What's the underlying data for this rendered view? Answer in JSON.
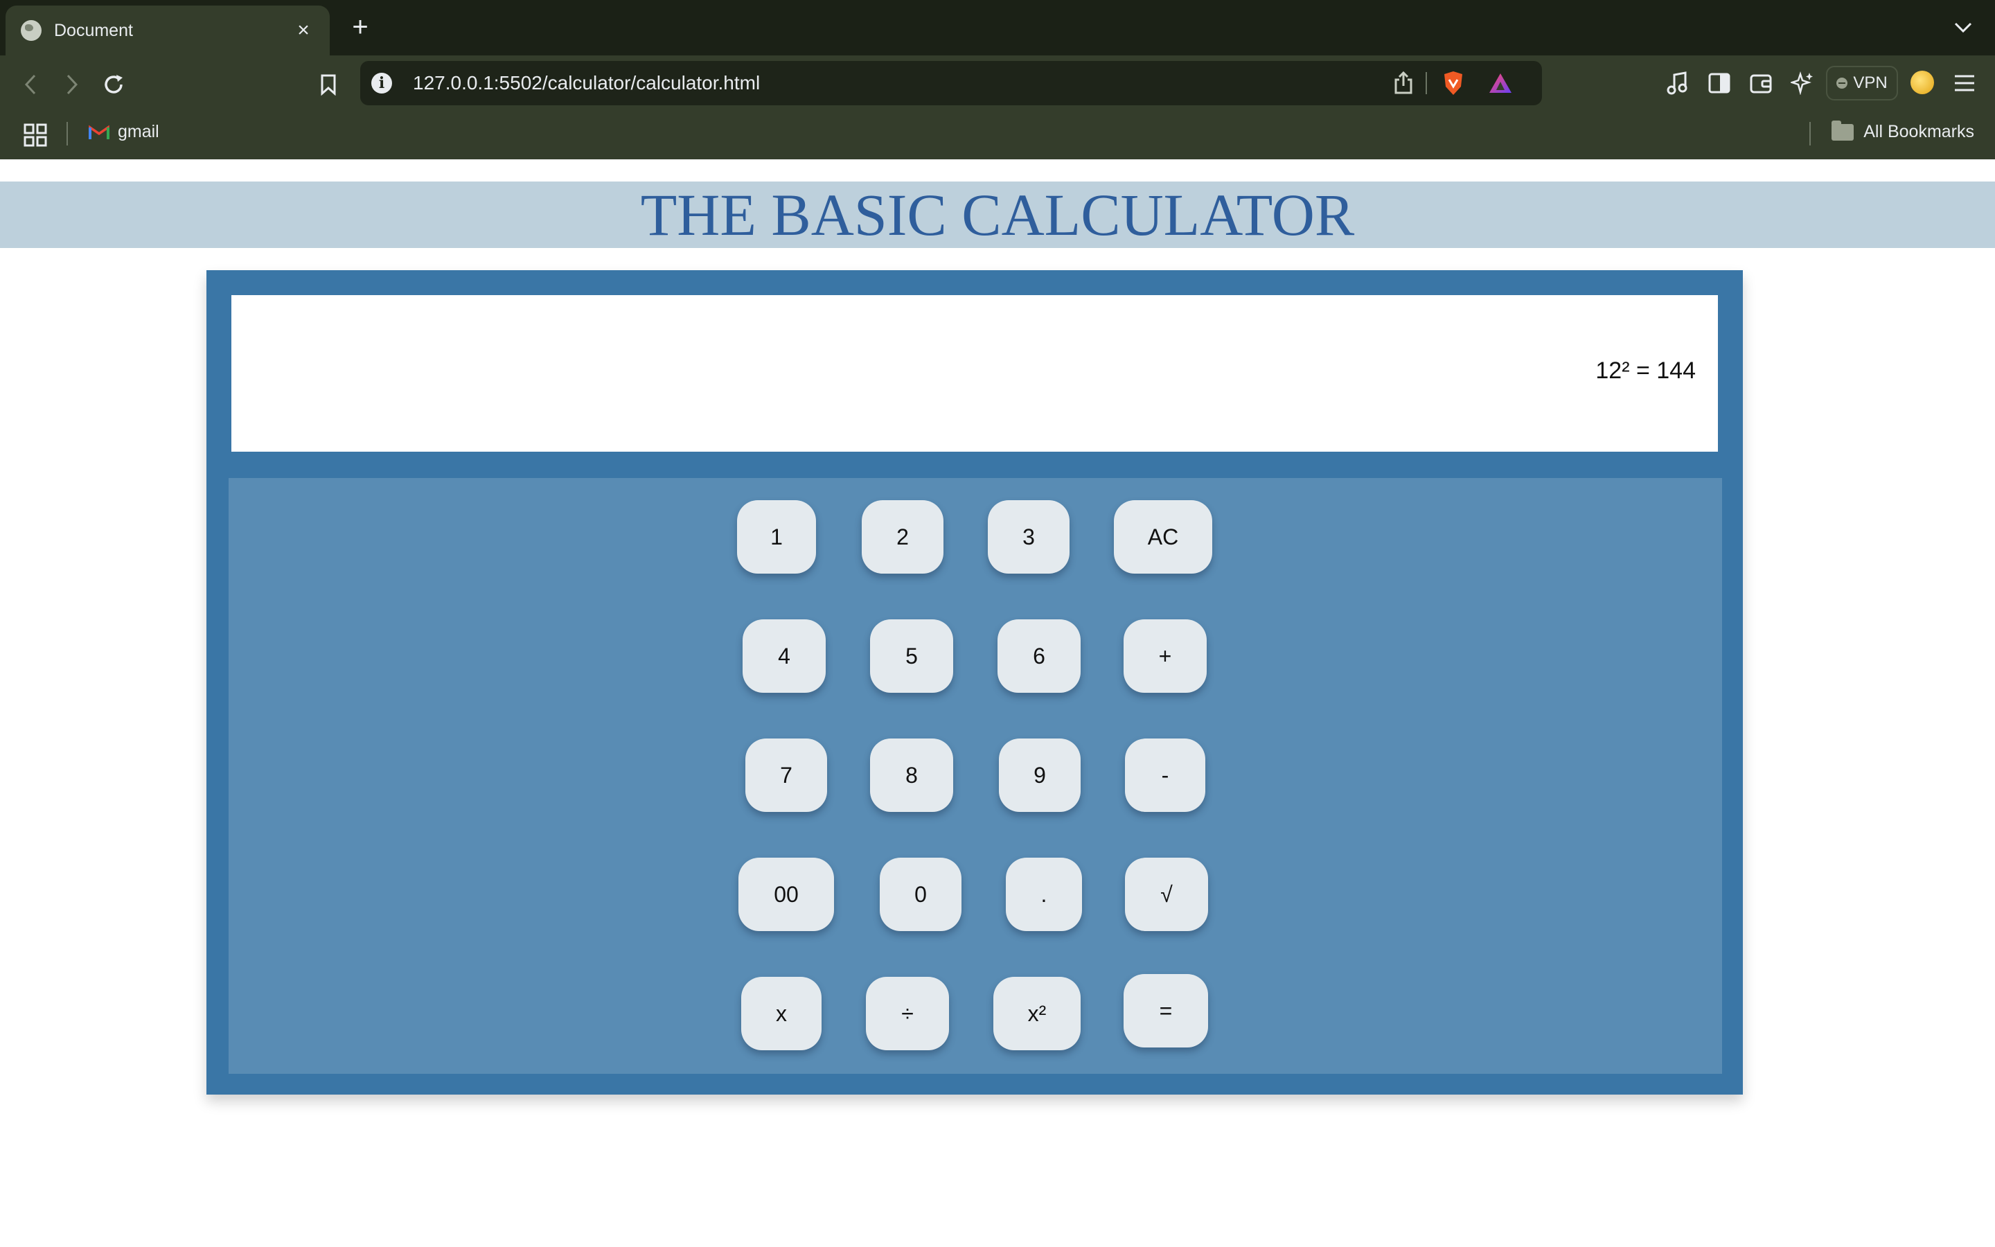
{
  "browser": {
    "tab_title": "Document",
    "url": "127.0.0.1:5502/calculator/calculator.html",
    "vpn_label": "VPN",
    "bookmarks": [
      {
        "label": "gmail"
      }
    ],
    "all_bookmarks_label": "All Bookmarks"
  },
  "page": {
    "heading": "THE BASIC CALCULATOR",
    "display_value": "12² = 144"
  },
  "keys": {
    "k1": "1",
    "k2": "2",
    "k3": "3",
    "ac": "AC",
    "k4": "4",
    "k5": "5",
    "k6": "6",
    "plus": "+",
    "k7": "7",
    "k8": "8",
    "k9": "9",
    "minus": "-",
    "k00": "00",
    "k0": "0",
    "dot": ".",
    "sqrt": "√",
    "mul": "x",
    "div": "÷",
    "sq": "x²",
    "eq": "="
  },
  "colors": {
    "chrome_dark": "#1b2116",
    "chrome_toolbar": "#343d2b",
    "header_band": "#bdd0dc",
    "heading_text": "#2f5e9c",
    "calc_frame": "#3a76a6",
    "keypad_bg": "#598cb4",
    "key_bg": "#e4eaee"
  }
}
